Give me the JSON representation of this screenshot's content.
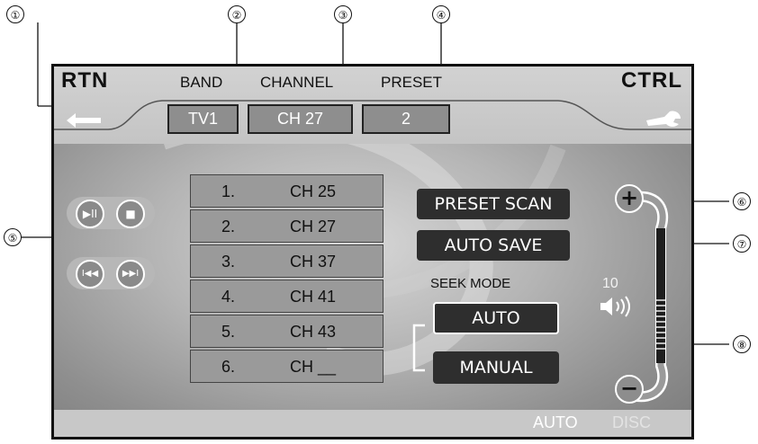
{
  "callouts": [
    "①",
    "②",
    "③",
    "④",
    "⑤",
    "⑥",
    "⑦",
    "⑧"
  ],
  "header": {
    "rtn_label": "RTN",
    "ctrl_label": "CTRL",
    "band_label": "BAND",
    "channel_label": "CHANNEL",
    "preset_label": "PRESET",
    "band_value": "TV1",
    "channel_value": "CH 27",
    "preset_value": "2",
    "rtn_icon": "back-arrow-icon",
    "ctrl_icon": "wrench-icon"
  },
  "preset_list": [
    {
      "num": "1.",
      "channel": "CH 25"
    },
    {
      "num": "2.",
      "channel": "CH 27"
    },
    {
      "num": "3.",
      "channel": "CH 37"
    },
    {
      "num": "4.",
      "channel": "CH 41"
    },
    {
      "num": "5.",
      "channel": "CH 43"
    },
    {
      "num": "6.",
      "channel": "CH __"
    }
  ],
  "transport": {
    "play_pause_glyph": "▶II",
    "stop_glyph": "■",
    "prev_glyph": "I◀◀",
    "next_glyph": "▶▶I"
  },
  "actions": {
    "preset_scan": "PRESET SCAN",
    "auto_save": "AUTO SAVE"
  },
  "seek": {
    "label": "SEEK MODE",
    "auto": "AUTO",
    "manual": "MANUAL",
    "selected": "AUTO"
  },
  "volume": {
    "level": "10",
    "plus_glyph": "+",
    "minus_glyph": "−",
    "icon": "speaker-icon"
  },
  "footer": {
    "auto": "AUTO",
    "disc": "DISC"
  }
}
